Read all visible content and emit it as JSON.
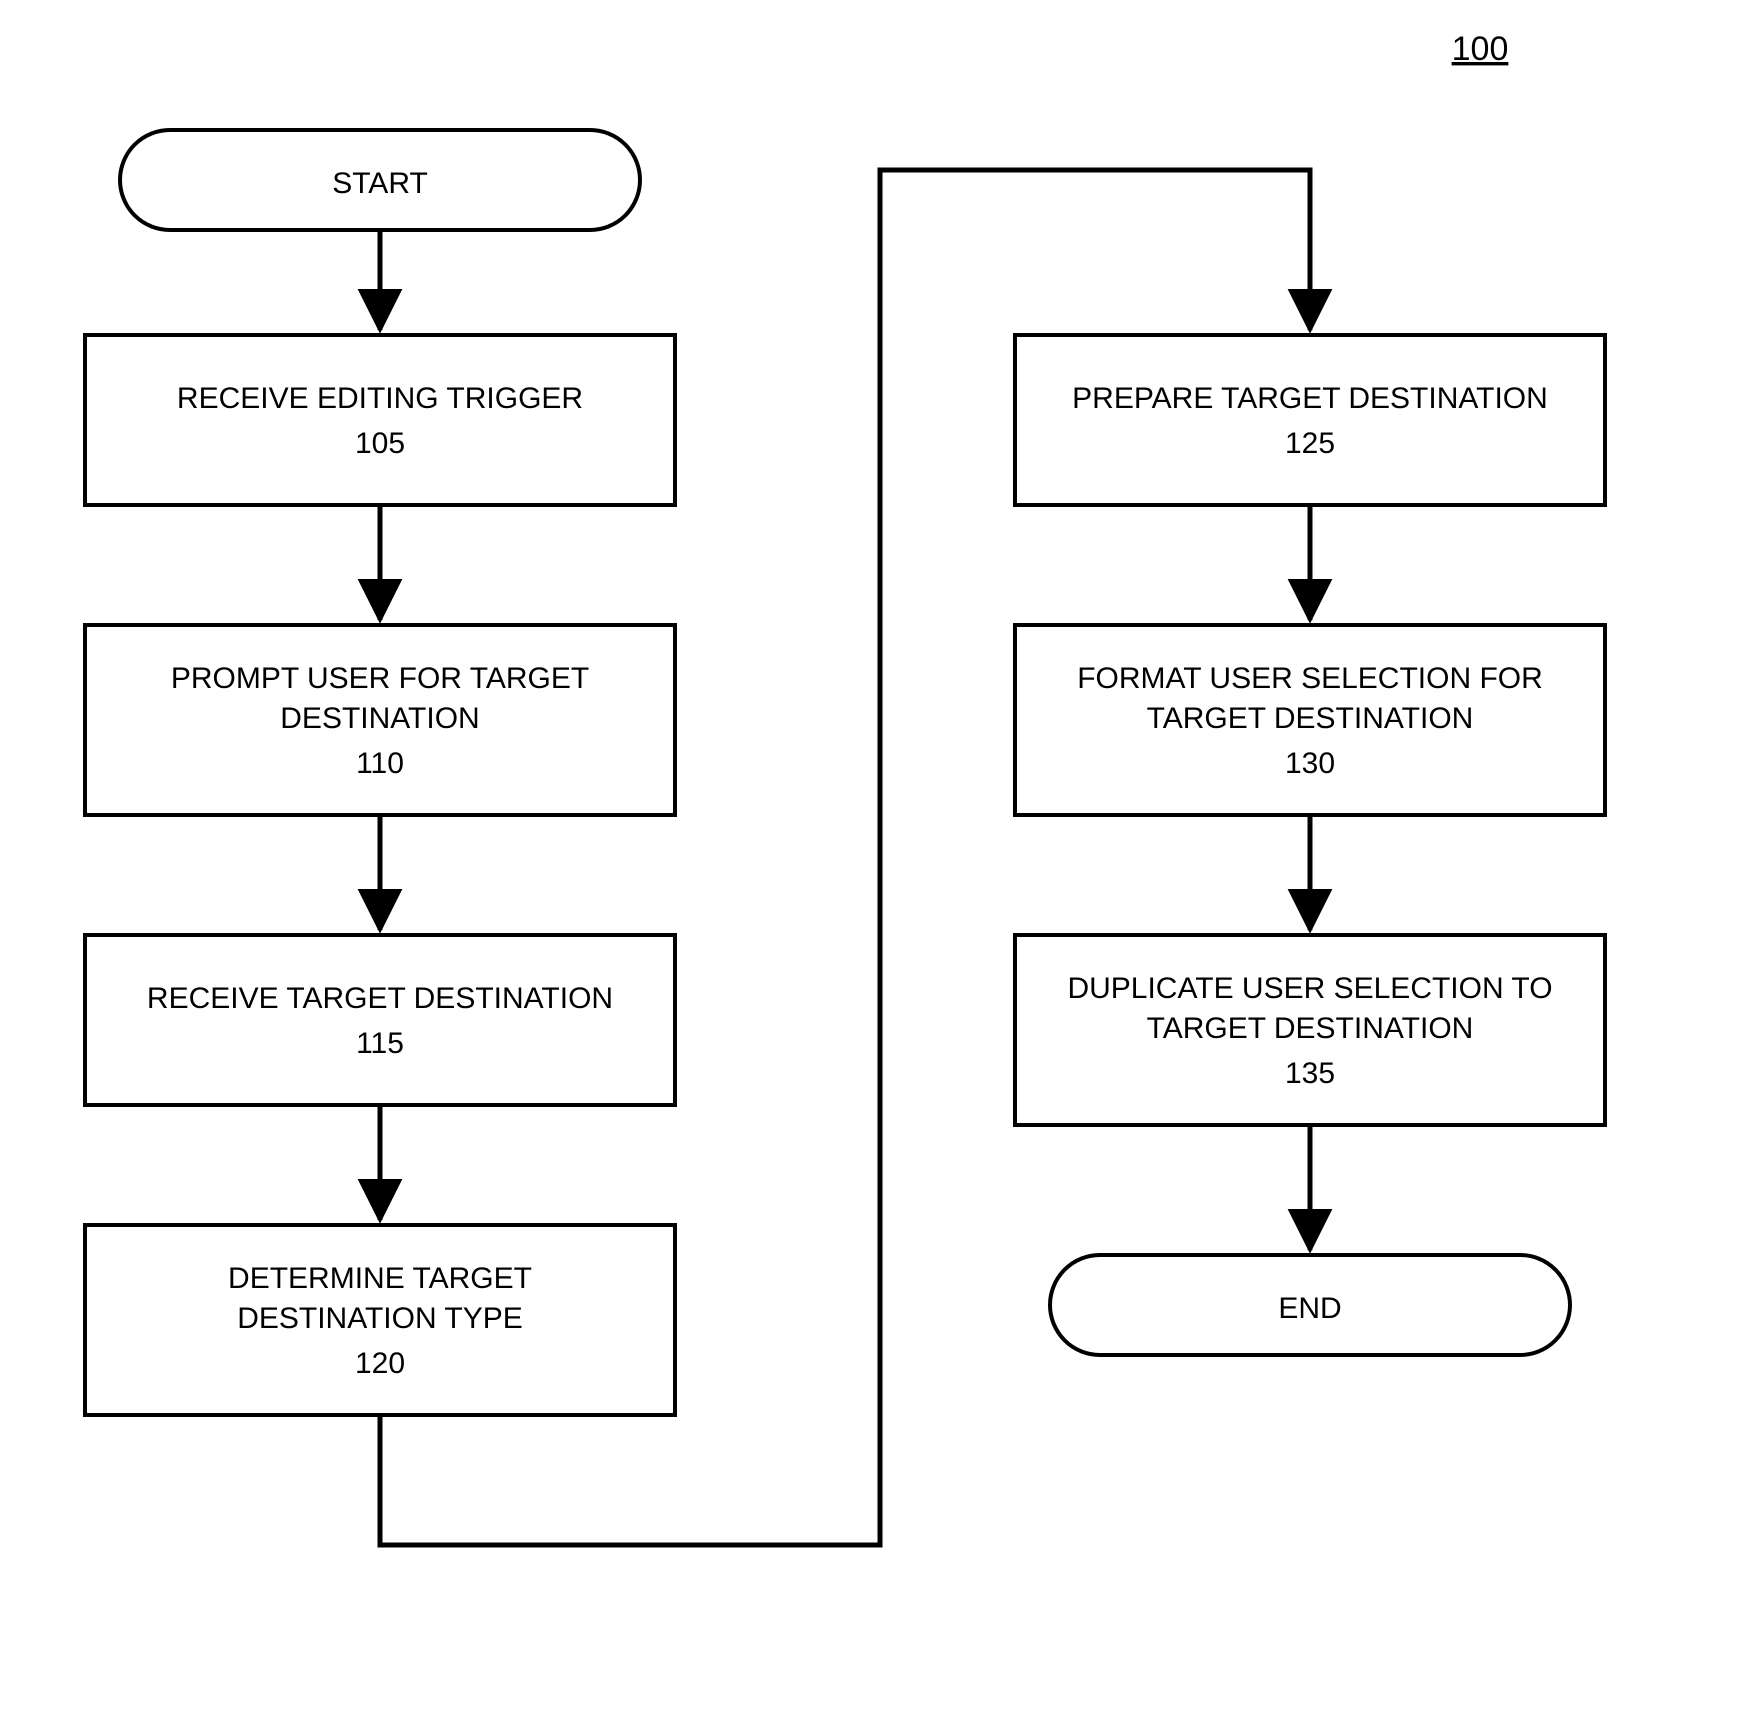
{
  "diagram_id": "100",
  "start": "START",
  "end": "END",
  "steps": {
    "s105": {
      "line1": "RECEIVE EDITING TRIGGER",
      "num": "105"
    },
    "s110": {
      "line1": "PROMPT USER FOR TARGET",
      "line2": "DESTINATION",
      "num": "110"
    },
    "s115": {
      "line1": "RECEIVE TARGET DESTINATION",
      "num": "115"
    },
    "s120": {
      "line1": "DETERMINE TARGET",
      "line2": "DESTINATION TYPE",
      "num": "120"
    },
    "s125": {
      "line1": "PREPARE TARGET DESTINATION",
      "num": "125"
    },
    "s130": {
      "line1": "FORMAT USER SELECTION FOR",
      "line2": "TARGET DESTINATION",
      "num": "130"
    },
    "s135": {
      "line1": "DUPLICATE USER SELECTION TO",
      "line2": "TARGET DESTINATION",
      "num": "135"
    }
  }
}
